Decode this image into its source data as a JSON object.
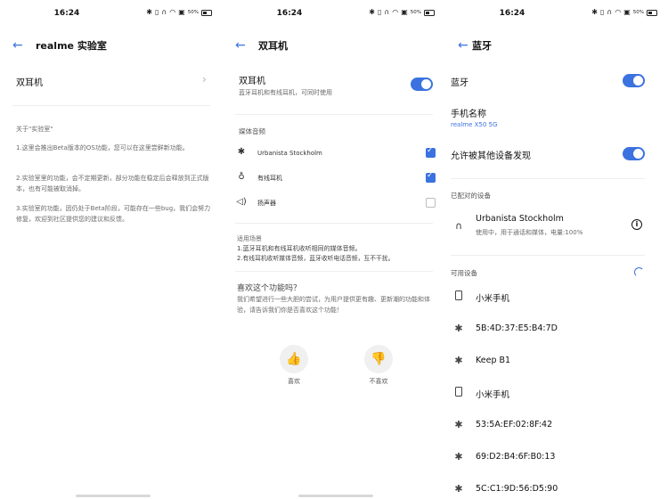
{
  "status": {
    "time": "16:24",
    "icons": [
      "bluetooth-icon",
      "vibrate-icon",
      "headphone-icon",
      "wifi-icon",
      "nfc-icon",
      "battery-icon"
    ],
    "battery_pct": "50%"
  },
  "panel1": {
    "title": "realme 实验室",
    "row_label": "双耳机",
    "about_heading": "关于\"实验室\"",
    "para1": "1.这里会推出Beta版本的OS功能，您可以在这里尝鲜新功能。",
    "para2": "2.实验室里的功能，会不定期更新，部分功能在稳定后会释放到正式版本，也有可能被取消掉。",
    "para3": "3.实验室的功能，因仍处于Beta阶段，可能存在一些bug，我们会努力修复，欢迎到社区提供您的建议和反馈。"
  },
  "panel2": {
    "title": "双耳机",
    "toggle_title": "双耳机",
    "toggle_sub": "蓝牙耳机和有线耳机，可同时使用",
    "toggle_on": true,
    "media_label": "媒体音频",
    "media_items": [
      {
        "icon": "bluetooth-icon",
        "label": "Urbanista Stockholm",
        "checked": true
      },
      {
        "icon": "wired-headphone-icon",
        "label": "有线耳机",
        "checked": true
      },
      {
        "icon": "speaker-icon",
        "label": "扬声器",
        "checked": false
      }
    ],
    "scenario_heading": "适用场景",
    "scenario_line1": "1.蓝牙耳机和有线耳机收听相同的媒体音频。",
    "scenario_line2": "2.有线耳机收听媒体音频，蓝牙收听电话音频，互不干扰。",
    "feedback_title": "喜欢这个功能吗？",
    "feedback_desc": "我们希望进行一些大胆的尝试，为用户提供更有趣、更新潮的功能和体验，请告诉我们你是否喜欢这个功能！",
    "like_label": "喜欢",
    "dislike_label": "不喜欢"
  },
  "panel3": {
    "title": "蓝牙",
    "bluetooth_label": "蓝牙",
    "bluetooth_on": true,
    "device_name_label": "手机名称",
    "device_name_value": "realme X50 5G",
    "discoverable_label": "允许被其他设备发现",
    "discoverable_on": true,
    "paired_heading": "已配对的设备",
    "paired_name": "Urbanista Stockholm",
    "paired_sub": "使用中，用于通话和媒体，电量:100%",
    "available_heading": "可用设备",
    "available": [
      {
        "icon": "phone-icon",
        "name": "小米手机"
      },
      {
        "icon": "bluetooth-icon",
        "name": "5B:4D:37:E5:B4:7D"
      },
      {
        "icon": "bluetooth-icon",
        "name": "Keep B1"
      },
      {
        "icon": "phone-icon",
        "name": "小米手机"
      },
      {
        "icon": "bluetooth-icon",
        "name": "53:5A:EF:02:8F:42"
      },
      {
        "icon": "bluetooth-icon",
        "name": "69:D2:B4:6F:B0:13"
      },
      {
        "icon": "bluetooth-icon",
        "name": "5C:C1:9D:56:D5:90"
      }
    ]
  },
  "colors": {
    "accent": "#3b72e0",
    "text": "#111111",
    "subtext": "#6a6a6a",
    "divider": "#eeeeee"
  }
}
